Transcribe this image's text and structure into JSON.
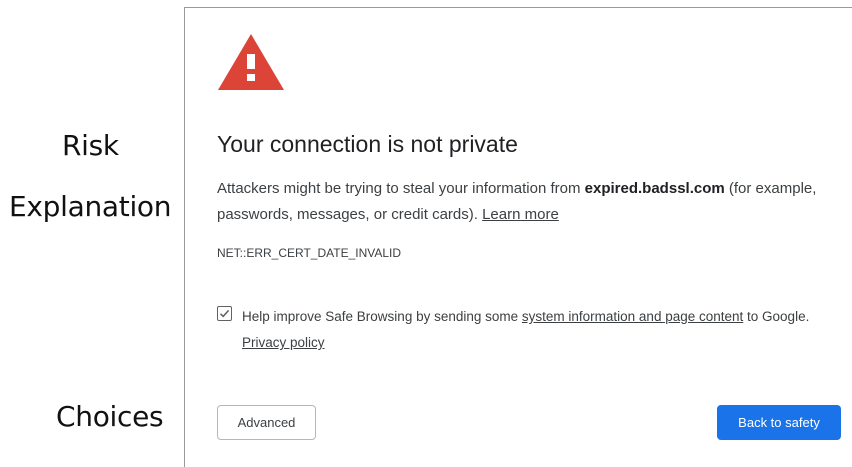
{
  "annotations": {
    "risk": "Risk",
    "explanation": "Explanation",
    "choices": "Choices"
  },
  "warning": {
    "icon": "warning-triangle-icon",
    "color": "#db4437",
    "glyph_color": "#ffffff"
  },
  "heading": "Your connection is not private",
  "explanation": {
    "prefix": "Attackers might be trying to steal your information from ",
    "domain": "expired.badssl.com",
    "suffix": " (for example, passwords, messages, or credit cards). ",
    "learn_more": "Learn more"
  },
  "error_code": "NET::ERR_CERT_DATE_INVALID",
  "safe_browsing": {
    "checked": true,
    "prefix": "Help improve Safe Browsing by sending some ",
    "link": "system information and page content",
    "suffix": " to Google. ",
    "privacy_link": "Privacy policy"
  },
  "buttons": {
    "advanced": "Advanced",
    "back_to_safety": "Back to safety",
    "primary_color": "#1a73e8"
  }
}
